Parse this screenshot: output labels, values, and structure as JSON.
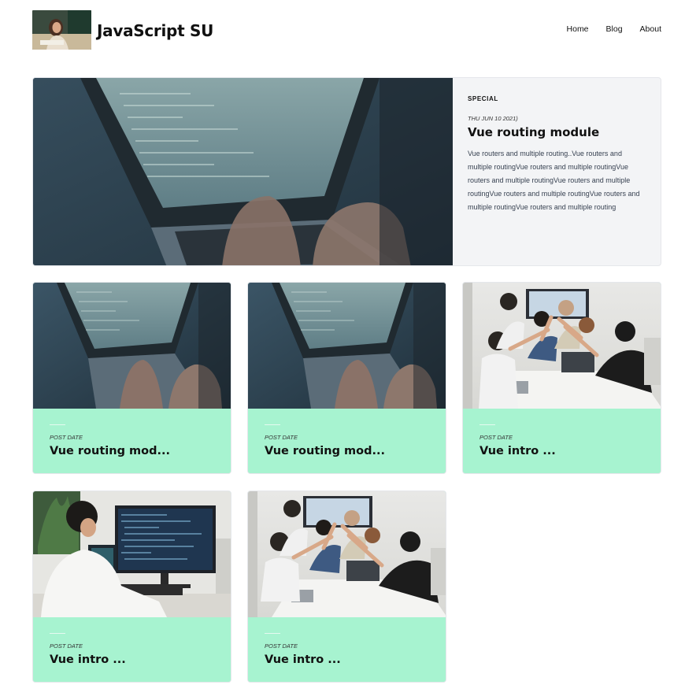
{
  "site": {
    "title": "JavaScript SU"
  },
  "nav": {
    "items": [
      "Home",
      "Blog",
      "About"
    ]
  },
  "hero": {
    "tag": "SPECIAL",
    "date": "THU JUN 10 2021)",
    "title": "Vue routing module",
    "excerpt": "Vue routers and multiple routing..Vue routers and multiple routingVue routers and multiple routingVue routers and multiple routingVue routers and multiple routingVue routers and multiple routingVue routers and multiple routingVue routers and multiple routing",
    "image": "laptop-code-photo"
  },
  "cards": [
    {
      "date_label": "POST DATE",
      "title": "Vue routing mod...",
      "image": "laptop-code-photo"
    },
    {
      "date_label": "POST DATE",
      "title": "Vue routing mod...",
      "image": "laptop-code-photo"
    },
    {
      "date_label": "POST DATE",
      "title": "Vue intro ...",
      "image": "team-high-five-photo"
    },
    {
      "date_label": "POST DATE",
      "title": "Vue intro ...",
      "image": "developer-monitor-photo"
    },
    {
      "date_label": "POST DATE",
      "title": "Vue intro ...",
      "image": "team-high-five-photo"
    }
  ],
  "colors": {
    "card_bg": "#a7f3d0",
    "hero_bg": "#f3f4f6",
    "text": "#111111"
  }
}
